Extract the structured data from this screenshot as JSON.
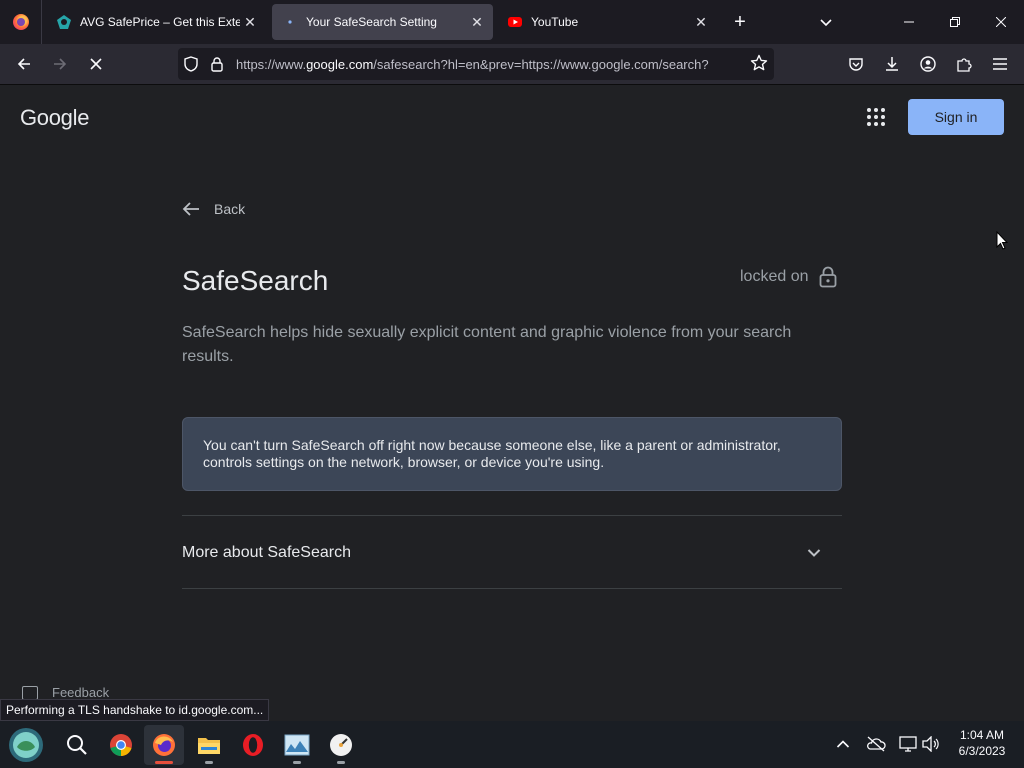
{
  "browser": {
    "tabs": [
      {
        "title": "AVG SafePrice – Get this Extensi",
        "icon": "avg-icon",
        "active": false
      },
      {
        "title": "Your SafeSearch Setting",
        "icon": "loading-dot-icon",
        "active": true
      },
      {
        "title": "YouTube",
        "icon": "youtube-icon",
        "active": false
      }
    ],
    "url": {
      "prefix": "https://www.",
      "host": "google.com",
      "path": "/safesearch?hl=en&prev=https://www.google.com/search?"
    },
    "status_text": "Performing a TLS handshake to id.google.com..."
  },
  "page": {
    "logo": "Google",
    "sign_in_label": "Sign in",
    "back_label": "Back",
    "title": "SafeSearch",
    "locked_label": "locked on",
    "description": "SafeSearch helps hide sexually explicit content and graphic violence from your search results.",
    "notice": "You can't turn SafeSearch off right now because someone else, like a parent or administrator, controls settings on the network, browser, or device you're using.",
    "more_label": "More about SafeSearch",
    "feedback_label": "Feedback"
  },
  "taskbar": {
    "time": "1:04 AM",
    "date": "6/3/2023",
    "apps": [
      "start-icon",
      "search-icon",
      "chrome-icon",
      "firefox-icon",
      "file-explorer-icon",
      "opera-icon",
      "photos-icon",
      "clock-app-icon"
    ]
  },
  "colors": {
    "accent": "#8ab4f8",
    "page_bg": "#202124",
    "notice_bg": "#3c4657"
  }
}
